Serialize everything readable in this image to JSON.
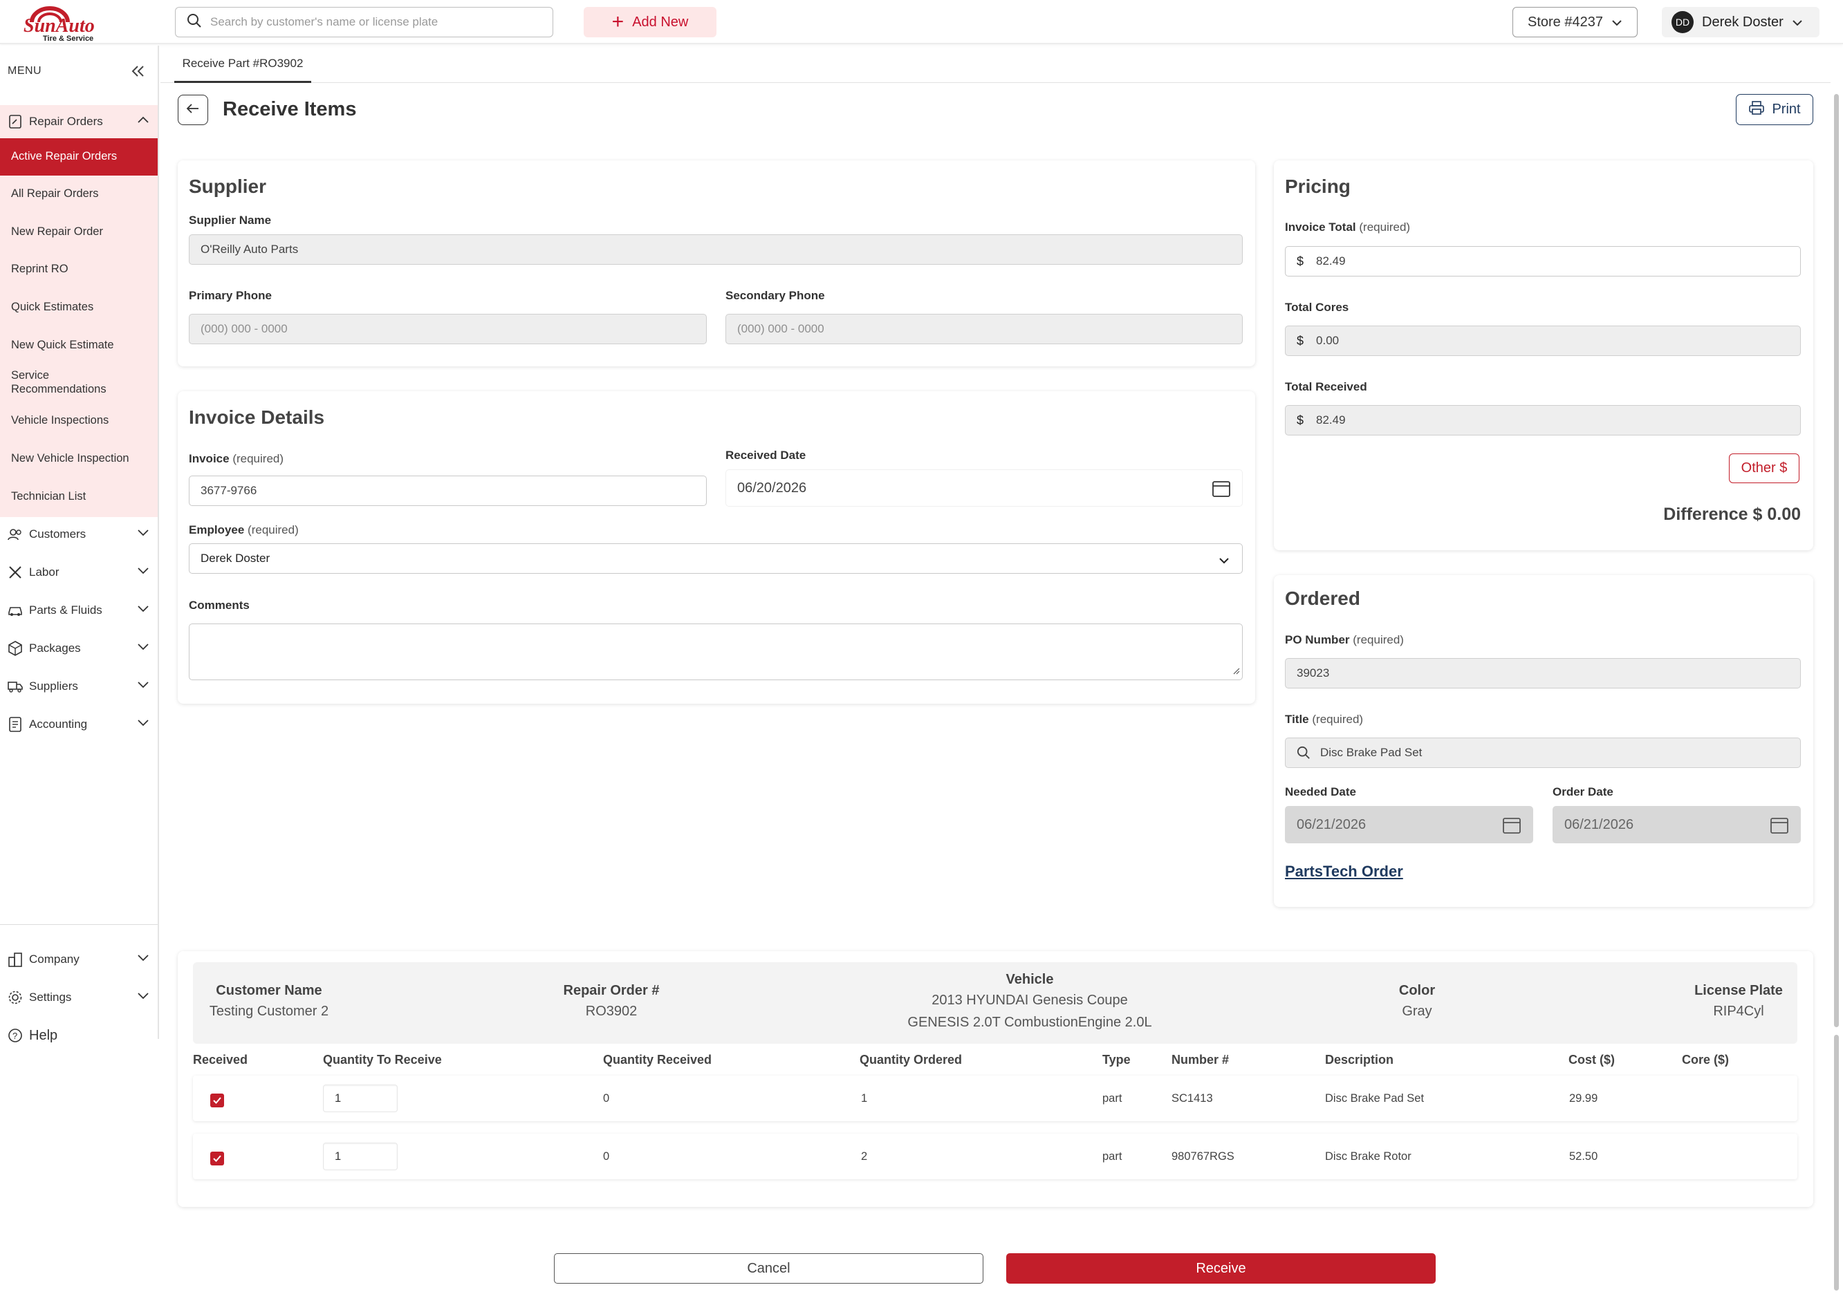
{
  "brand": {
    "name": "SunAuto",
    "tagline": "Tire & Service",
    "accent": "#c21e2a",
    "navy": "#1f3a5f"
  },
  "header": {
    "search_placeholder": "Search by customer's name or license plate",
    "add_new": "Add New",
    "store": "Store #4237",
    "user_initials": "DD",
    "user_name": "Derek Doster"
  },
  "sidebar": {
    "menu_label": "MENU",
    "repair_orders": "Repair Orders",
    "sub_items": [
      "Active Repair Orders",
      "All Repair Orders",
      "New Repair Order",
      "Reprint RO",
      "Quick Estimates",
      "New Quick Estimate",
      "Service Recommendations",
      "Vehicle Inspections",
      "New Vehicle Inspection",
      "Technician List"
    ],
    "groups": [
      "Customers",
      "Labor",
      "Parts & Fluids",
      "Packages",
      "Suppliers",
      "Accounting"
    ],
    "bottom": [
      "Company",
      "Settings"
    ],
    "help": "Help"
  },
  "tab": {
    "label": "Receive Part #RO3902"
  },
  "page": {
    "title": "Receive Items",
    "print": "Print"
  },
  "supplier": {
    "title": "Supplier",
    "name_label": "Supplier Name",
    "name_value": "O'Reilly Auto Parts",
    "primary_phone_label": "Primary Phone",
    "primary_phone_ph": "(000) 000 - 0000",
    "secondary_phone_label": "Secondary Phone",
    "secondary_phone_ph": "(000) 000 - 0000"
  },
  "invoice": {
    "title": "Invoice Details",
    "invoice_label": "Invoice",
    "required": "(required)",
    "invoice_value": "3677-9766",
    "received_date_label": "Received Date",
    "received_date": "06/20/2026",
    "employee_label": "Employee",
    "employee_value": "Derek Doster",
    "comments_label": "Comments"
  },
  "pricing": {
    "title": "Pricing",
    "invoice_total_label": "Invoice Total",
    "required": "(required)",
    "currency": "$",
    "invoice_total": "82.49",
    "total_cores_label": "Total Cores",
    "total_cores": "0.00",
    "total_received_label": "Total Received",
    "total_received": "82.49",
    "other_button": "Other $",
    "difference": "Difference $ 0.00"
  },
  "ordered": {
    "title": "Ordered",
    "po_label": "PO Number",
    "required": "(required)",
    "po_value": "39023",
    "title_label": "Title",
    "title_value": "Disc Brake Pad Set",
    "needed_label": "Needed Date",
    "needed_date": "06/21/2026",
    "order_label": "Order Date",
    "order_date": "06/21/2026",
    "partstech": "PartsTech Order"
  },
  "summary": {
    "customer_h": "Customer Name",
    "customer_v": "Testing Customer 2",
    "ro_h": "Repair Order #",
    "ro_v": "RO3902",
    "vehicle_h": "Vehicle",
    "vehicle_v1": "2013 HYUNDAI Genesis Coupe",
    "vehicle_v2": "GENESIS 2.0T CombustionEngine 2.0L",
    "color_h": "Color",
    "color_v": "Gray",
    "plate_h": "License Plate",
    "plate_v": "RIP4Cyl"
  },
  "table": {
    "headers": [
      "Received",
      "Quantity To Receive",
      "Quantity Received",
      "Quantity Ordered",
      "Type",
      "Number #",
      "Description",
      "Cost ($)",
      "Core ($)"
    ],
    "rows": [
      {
        "to_receive": "1",
        "received": "0",
        "ordered": "1",
        "type": "part",
        "number": "SC1413",
        "description": "Disc Brake Pad Set",
        "cost": "29.99",
        "core": ""
      },
      {
        "to_receive": "1",
        "received": "0",
        "ordered": "2",
        "type": "part",
        "number": "980767RGS",
        "description": "Disc Brake Rotor",
        "cost": "52.50",
        "core": ""
      }
    ]
  },
  "actions": {
    "cancel": "Cancel",
    "receive": "Receive"
  }
}
